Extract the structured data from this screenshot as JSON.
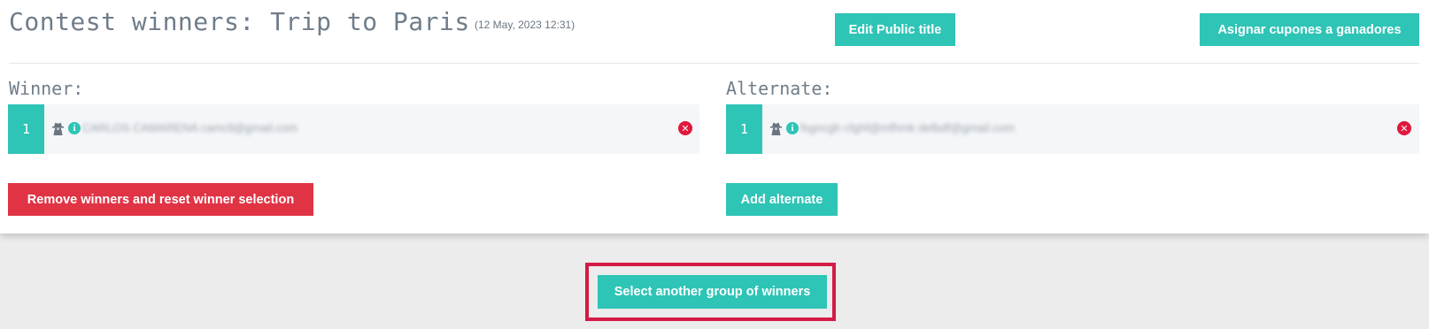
{
  "header": {
    "title": "Contest winners: Trip to Paris",
    "date": "(12 May, 2023 12:31)",
    "edit_title_button": "Edit Public title",
    "assign_coupons_button": "Asignar cupones a ganadores"
  },
  "winner": {
    "label": "Winner:",
    "entries": [
      {
        "number": "1",
        "text": "CARLOS CAMARENA camcll@gmail.com",
        "icons": [
          "spy-icon",
          "info-icon",
          "remove-icon"
        ]
      }
    ],
    "remove_button": "Remove winners and reset winner selection"
  },
  "alternate": {
    "label": "Alternate:",
    "entries": [
      {
        "number": "1",
        "text": "fsgncgh cfghf@mfhmk defbdf@gmail.com",
        "icons": [
          "spy-icon",
          "info-icon",
          "remove-icon"
        ]
      }
    ],
    "add_button": "Add alternate"
  },
  "footer": {
    "select_group_button": "Select another group of winners"
  },
  "colors": {
    "teal": "#2ec4b6",
    "red": "#e03445",
    "highlight": "#d51a45",
    "background": "#ececec"
  }
}
